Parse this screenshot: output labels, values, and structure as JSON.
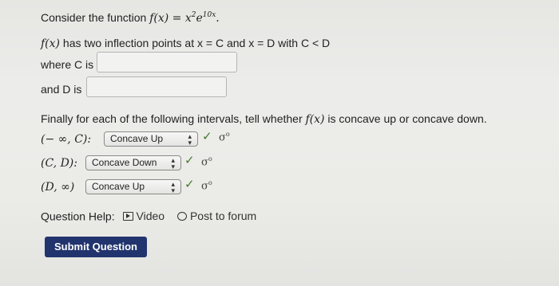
{
  "question": {
    "intro": "Consider the function",
    "function_expr_base": "f(x) = x",
    "function_expr_exp1": "2",
    "function_expr_mid": "e",
    "function_expr_exp2": "10x",
    "function_end": ".",
    "inflection_fx": "f(x)",
    "inflection_text": "has two inflection points at x = C and x = D with C < D",
    "where_c_label": "where C is",
    "and_d_label": "and D is",
    "concavity_prompt_a": "Finally for each of the following intervals, tell whether",
    "concavity_fx": "f(x)",
    "concavity_prompt_b": "is concave up or concave down."
  },
  "intervals": [
    {
      "label": "(− ∞, C):",
      "selected": "Concave Up",
      "check": "✓",
      "reveal": "σ"
    },
    {
      "label": "(C, D):",
      "selected": "Concave Down",
      "check": "✓",
      "reveal": "σ"
    },
    {
      "label": "(D, ∞)",
      "selected": "Concave Up",
      "check": "✓",
      "reveal": "σ"
    }
  ],
  "help": {
    "label": "Question Help:",
    "video": "Video",
    "forum": "Post to forum"
  },
  "submit": {
    "label": "Submit Question"
  },
  "colors": {
    "submit_bg": "#21346d",
    "check": "#4a7a2f"
  }
}
